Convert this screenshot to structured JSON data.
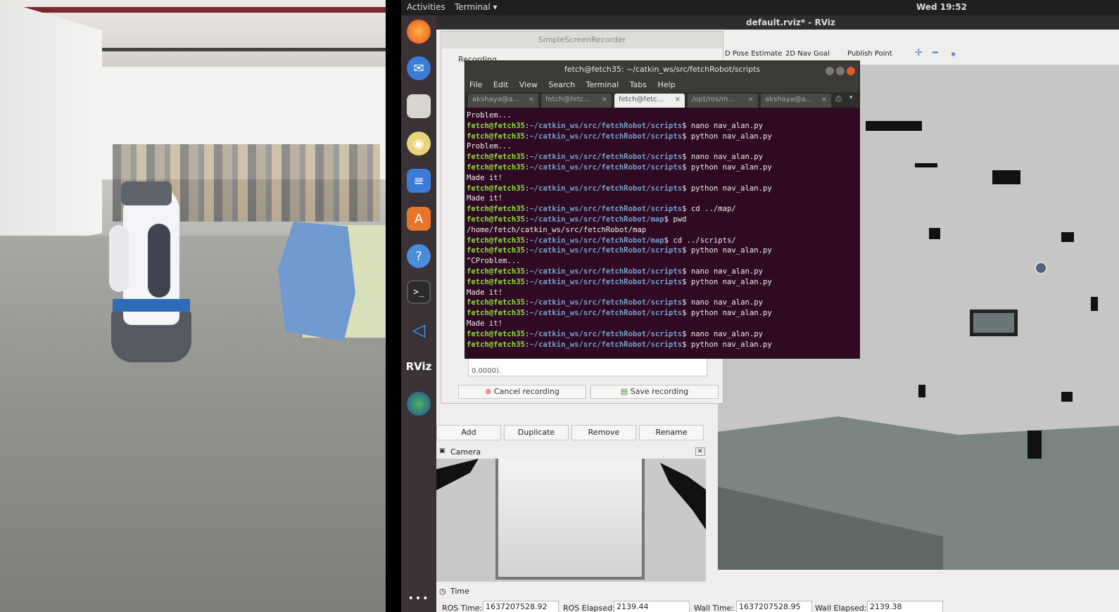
{
  "topbar": {
    "activities": "Activities",
    "app_menu": "Terminal ▾",
    "clock": "Wed 19:52"
  },
  "rviz": {
    "title": "default.rviz* - RViz",
    "tools": [
      "D Pose Estimate",
      "2D Nav Goal",
      "Publish Point"
    ],
    "buttons": [
      "Add",
      "Duplicate",
      "Remove",
      "Rename"
    ],
    "camera_label": "Camera",
    "time_label": "Time",
    "time": {
      "ros_time_label": "ROS Time:",
      "ros_time": "1637207528.92",
      "ros_elapsed_label": "ROS Elapsed:",
      "ros_elapsed": "2139.44",
      "wall_time_label": "Wall Time:",
      "wall_time": "1637207528.95",
      "wall_elapsed_label": "Wall Elapsed:",
      "wall_elapsed": "2139.38"
    }
  },
  "recorder": {
    "title": "SimpleScreenRecorder",
    "section": "Recording",
    "log_text": "0.0000).",
    "cancel": "Cancel recording",
    "save": "Save recording"
  },
  "terminal": {
    "title": "fetch@fetch35: ~/catkin_ws/src/fetchRobot/scripts",
    "menu": [
      "File",
      "Edit",
      "View",
      "Search",
      "Terminal",
      "Tabs",
      "Help"
    ],
    "tabs": [
      "akshaya@a...",
      "fetch@fetc...",
      "fetch@fetc...",
      "/opt/ros/m...",
      "akshaya@a..."
    ],
    "active_tab": 2,
    "lines": [
      {
        "out": "Problem..."
      },
      {
        "prompt": "fetch@fetch35",
        "path": "~/catkin_ws/src/fetchRobot/scripts",
        "cmd": "$ nano nav_alan.py"
      },
      {
        "prompt": "fetch@fetch35",
        "path": "~/catkin_ws/src/fetchRobot/scripts",
        "cmd": "$ python nav_alan.py"
      },
      {
        "out": "Problem..."
      },
      {
        "prompt": "fetch@fetch35",
        "path": "~/catkin_ws/src/fetchRobot/scripts",
        "cmd": "$ nano nav_alan.py"
      },
      {
        "prompt": "fetch@fetch35",
        "path": "~/catkin_ws/src/fetchRobot/scripts",
        "cmd": "$ python nav_alan.py"
      },
      {
        "out": "Made it!"
      },
      {
        "prompt": "fetch@fetch35",
        "path": "~/catkin_ws/src/fetchRobot/scripts",
        "cmd": "$ python nav_alan.py"
      },
      {
        "out": "Made it!"
      },
      {
        "prompt": "fetch@fetch35",
        "path": "~/catkin_ws/src/fetchRobot/scripts",
        "cmd": "$ cd ../map/"
      },
      {
        "prompt": "fetch@fetch35",
        "path": "~/catkin_ws/src/fetchRobot/map",
        "cmd": "$ pwd"
      },
      {
        "out": "/home/fetch/catkin_ws/src/fetchRobot/map"
      },
      {
        "prompt": "fetch@fetch35",
        "path": "~/catkin_ws/src/fetchRobot/map",
        "cmd": "$ cd ../scripts/"
      },
      {
        "prompt": "fetch@fetch35",
        "path": "~/catkin_ws/src/fetchRobot/scripts",
        "cmd": "$ python nav_alan.py"
      },
      {
        "out": "^CProblem..."
      },
      {
        "prompt": "fetch@fetch35",
        "path": "~/catkin_ws/src/fetchRobot/scripts",
        "cmd": "$ nano nav_alan.py"
      },
      {
        "prompt": "fetch@fetch35",
        "path": "~/catkin_ws/src/fetchRobot/scripts",
        "cmd": "$ python nav_alan.py"
      },
      {
        "out": "Made it!"
      },
      {
        "prompt": "fetch@fetch35",
        "path": "~/catkin_ws/src/fetchRobot/scripts",
        "cmd": "$ nano nav_alan.py"
      },
      {
        "prompt": "fetch@fetch35",
        "path": "~/catkin_ws/src/fetchRobot/scripts",
        "cmd": "$ python nav_alan.py"
      },
      {
        "out": "Made it!"
      },
      {
        "prompt": "fetch@fetch35",
        "path": "~/catkin_ws/src/fetchRobot/scripts",
        "cmd": "$ nano nav_alan.py"
      },
      {
        "prompt": "fetch@fetch35",
        "path": "~/catkin_ws/src/fetchRobot/scripts",
        "cmd": "$ python nav_alan.py"
      }
    ]
  },
  "dock": [
    "firefox-icon",
    "thunderbird-icon",
    "files-icon",
    "rhythmbox-icon",
    "writer-icon",
    "software-center-icon",
    "help-icon",
    "terminal-icon",
    "vscode-icon",
    "rviz-icon",
    "globe-icon",
    "app-grid-icon"
  ],
  "dock_rviz_text": "RViz",
  "colors": {
    "terminal_bg": "#300a24",
    "prompt": "#8ae234",
    "path": "#729fcf",
    "dock_bg": "#3a3236"
  }
}
